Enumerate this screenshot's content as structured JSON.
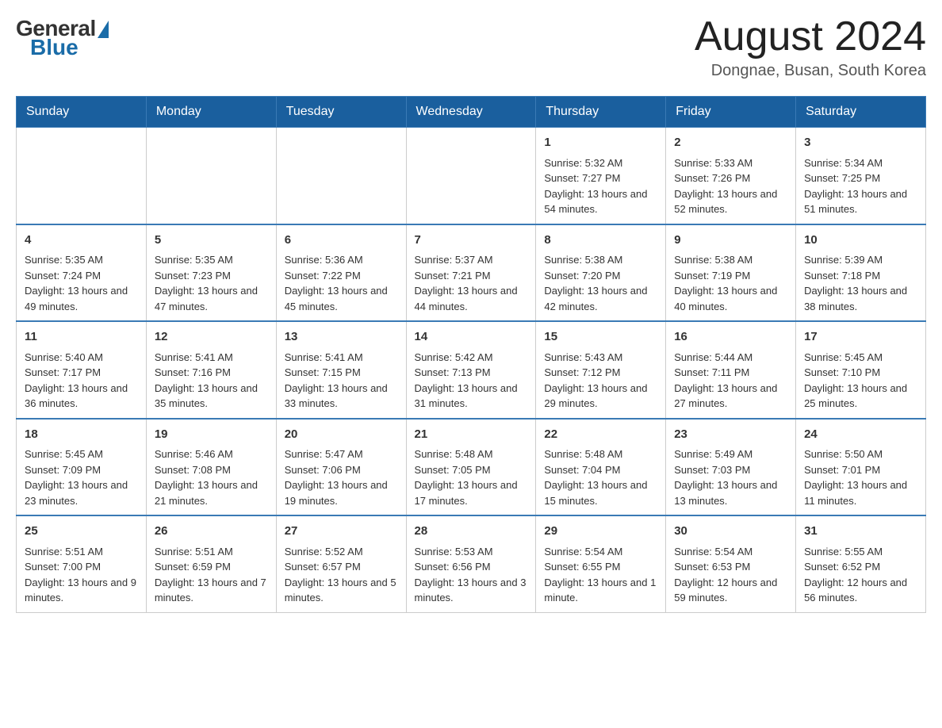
{
  "header": {
    "logo": {
      "general_text": "General",
      "blue_text": "Blue"
    },
    "title": "August 2024",
    "location": "Dongnae, Busan, South Korea"
  },
  "days_of_week": [
    "Sunday",
    "Monday",
    "Tuesday",
    "Wednesday",
    "Thursday",
    "Friday",
    "Saturday"
  ],
  "weeks": [
    [
      {
        "day": "",
        "info": ""
      },
      {
        "day": "",
        "info": ""
      },
      {
        "day": "",
        "info": ""
      },
      {
        "day": "",
        "info": ""
      },
      {
        "day": "1",
        "info": "Sunrise: 5:32 AM\nSunset: 7:27 PM\nDaylight: 13 hours and 54 minutes."
      },
      {
        "day": "2",
        "info": "Sunrise: 5:33 AM\nSunset: 7:26 PM\nDaylight: 13 hours and 52 minutes."
      },
      {
        "day": "3",
        "info": "Sunrise: 5:34 AM\nSunset: 7:25 PM\nDaylight: 13 hours and 51 minutes."
      }
    ],
    [
      {
        "day": "4",
        "info": "Sunrise: 5:35 AM\nSunset: 7:24 PM\nDaylight: 13 hours and 49 minutes."
      },
      {
        "day": "5",
        "info": "Sunrise: 5:35 AM\nSunset: 7:23 PM\nDaylight: 13 hours and 47 minutes."
      },
      {
        "day": "6",
        "info": "Sunrise: 5:36 AM\nSunset: 7:22 PM\nDaylight: 13 hours and 45 minutes."
      },
      {
        "day": "7",
        "info": "Sunrise: 5:37 AM\nSunset: 7:21 PM\nDaylight: 13 hours and 44 minutes."
      },
      {
        "day": "8",
        "info": "Sunrise: 5:38 AM\nSunset: 7:20 PM\nDaylight: 13 hours and 42 minutes."
      },
      {
        "day": "9",
        "info": "Sunrise: 5:38 AM\nSunset: 7:19 PM\nDaylight: 13 hours and 40 minutes."
      },
      {
        "day": "10",
        "info": "Sunrise: 5:39 AM\nSunset: 7:18 PM\nDaylight: 13 hours and 38 minutes."
      }
    ],
    [
      {
        "day": "11",
        "info": "Sunrise: 5:40 AM\nSunset: 7:17 PM\nDaylight: 13 hours and 36 minutes."
      },
      {
        "day": "12",
        "info": "Sunrise: 5:41 AM\nSunset: 7:16 PM\nDaylight: 13 hours and 35 minutes."
      },
      {
        "day": "13",
        "info": "Sunrise: 5:41 AM\nSunset: 7:15 PM\nDaylight: 13 hours and 33 minutes."
      },
      {
        "day": "14",
        "info": "Sunrise: 5:42 AM\nSunset: 7:13 PM\nDaylight: 13 hours and 31 minutes."
      },
      {
        "day": "15",
        "info": "Sunrise: 5:43 AM\nSunset: 7:12 PM\nDaylight: 13 hours and 29 minutes."
      },
      {
        "day": "16",
        "info": "Sunrise: 5:44 AM\nSunset: 7:11 PM\nDaylight: 13 hours and 27 minutes."
      },
      {
        "day": "17",
        "info": "Sunrise: 5:45 AM\nSunset: 7:10 PM\nDaylight: 13 hours and 25 minutes."
      }
    ],
    [
      {
        "day": "18",
        "info": "Sunrise: 5:45 AM\nSunset: 7:09 PM\nDaylight: 13 hours and 23 minutes."
      },
      {
        "day": "19",
        "info": "Sunrise: 5:46 AM\nSunset: 7:08 PM\nDaylight: 13 hours and 21 minutes."
      },
      {
        "day": "20",
        "info": "Sunrise: 5:47 AM\nSunset: 7:06 PM\nDaylight: 13 hours and 19 minutes."
      },
      {
        "day": "21",
        "info": "Sunrise: 5:48 AM\nSunset: 7:05 PM\nDaylight: 13 hours and 17 minutes."
      },
      {
        "day": "22",
        "info": "Sunrise: 5:48 AM\nSunset: 7:04 PM\nDaylight: 13 hours and 15 minutes."
      },
      {
        "day": "23",
        "info": "Sunrise: 5:49 AM\nSunset: 7:03 PM\nDaylight: 13 hours and 13 minutes."
      },
      {
        "day": "24",
        "info": "Sunrise: 5:50 AM\nSunset: 7:01 PM\nDaylight: 13 hours and 11 minutes."
      }
    ],
    [
      {
        "day": "25",
        "info": "Sunrise: 5:51 AM\nSunset: 7:00 PM\nDaylight: 13 hours and 9 minutes."
      },
      {
        "day": "26",
        "info": "Sunrise: 5:51 AM\nSunset: 6:59 PM\nDaylight: 13 hours and 7 minutes."
      },
      {
        "day": "27",
        "info": "Sunrise: 5:52 AM\nSunset: 6:57 PM\nDaylight: 13 hours and 5 minutes."
      },
      {
        "day": "28",
        "info": "Sunrise: 5:53 AM\nSunset: 6:56 PM\nDaylight: 13 hours and 3 minutes."
      },
      {
        "day": "29",
        "info": "Sunrise: 5:54 AM\nSunset: 6:55 PM\nDaylight: 13 hours and 1 minute."
      },
      {
        "day": "30",
        "info": "Sunrise: 5:54 AM\nSunset: 6:53 PM\nDaylight: 12 hours and 59 minutes."
      },
      {
        "day": "31",
        "info": "Sunrise: 5:55 AM\nSunset: 6:52 PM\nDaylight: 12 hours and 56 minutes."
      }
    ]
  ]
}
